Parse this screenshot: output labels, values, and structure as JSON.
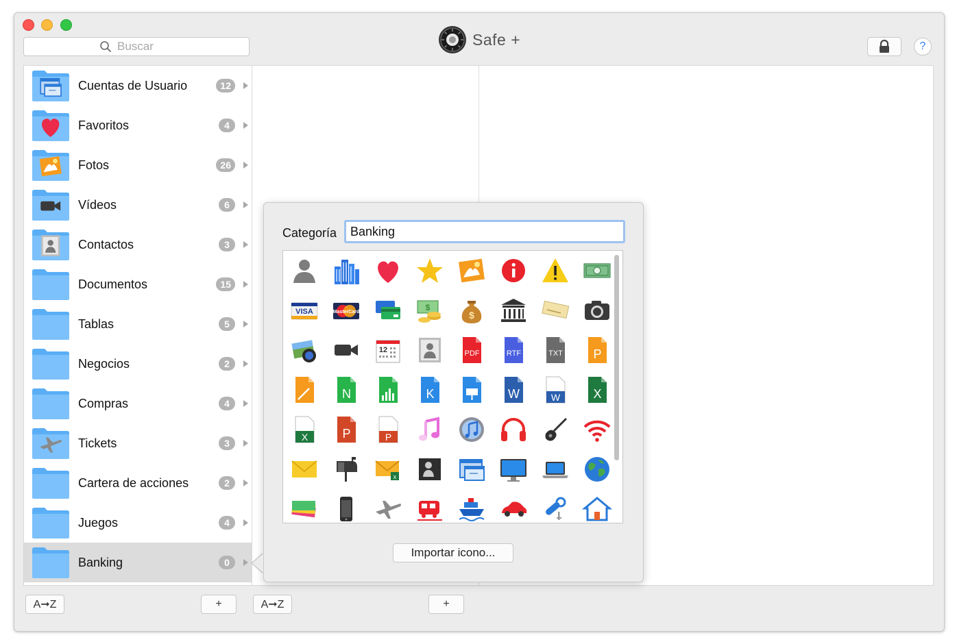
{
  "window": {
    "app_title": "Safe +",
    "search_placeholder": "Buscar"
  },
  "sidebar": {
    "items": [
      {
        "label": "Cuentas de Usuario",
        "count": "12",
        "icon": "browser-window-icon"
      },
      {
        "label": "Favoritos",
        "count": "4",
        "icon": "heart-icon"
      },
      {
        "label": "Fotos",
        "count": "26",
        "icon": "photo-icon"
      },
      {
        "label": "Vídeos",
        "count": "6",
        "icon": "video-camera-icon"
      },
      {
        "label": "Contactos",
        "count": "3",
        "icon": "contacts-icon"
      },
      {
        "label": "Documentos",
        "count": "15",
        "icon": "word-document-icon"
      },
      {
        "label": "Tablas",
        "count": "5",
        "icon": "excel-sheet-icon"
      },
      {
        "label": "Negocios",
        "count": "2",
        "icon": "briefcase-icon"
      },
      {
        "label": "Compras",
        "count": "4",
        "icon": "shopping-bag-icon"
      },
      {
        "label": "Tickets",
        "count": "3",
        "icon": "airplane-icon"
      },
      {
        "label": "Cartera de acciones",
        "count": "2",
        "icon": "stock-chart-icon"
      },
      {
        "label": "Juegos",
        "count": "4",
        "icon": "gamepad-icon"
      },
      {
        "label": "Banking",
        "count": "0",
        "icon": "money-icon",
        "selected": true
      }
    ]
  },
  "bottom_bar": {
    "sort_label": "A➞Z",
    "add_label": "+"
  },
  "popover": {
    "category_label": "Categoría",
    "category_value": "Banking",
    "import_button": "Importar icono...",
    "icon_text": {
      "visa": "VISA",
      "mastercard": "MasterCard",
      "calendar_day": "12",
      "pdf": "PDF",
      "rtf": "RTF",
      "txt": "TXT",
      "pages": "P",
      "numbers": "N",
      "keynote": "K",
      "word": "W",
      "excel": "X",
      "powerpoint": "P"
    },
    "icons": [
      "person-icon",
      "buildings-icon",
      "heart-icon",
      "star-icon",
      "photo-icon",
      "info-icon",
      "warning-icon",
      "banknote-icon",
      "visa-card-icon",
      "mastercard-icon",
      "credit-cards-icon",
      "money-coins-icon",
      "money-bag-icon",
      "bank-icon",
      "check-icon",
      "camera-icon",
      "photos-globe-icon",
      "video-camera-icon",
      "calendar-icon",
      "contacts-icon",
      "pdf-file-icon",
      "rtf-file-icon",
      "txt-file-icon",
      "pages-file-icon",
      "pages-doc-icon",
      "numbers-file-icon",
      "numbers-chart-icon",
      "keynote-file-icon",
      "keynote-doc-icon",
      "word-file-icon",
      "word-doc-icon",
      "excel-file-icon",
      "excel-doc-icon",
      "powerpoint-file-icon",
      "powerpoint-doc-icon",
      "music-note-icon",
      "itunes-icon",
      "headphones-icon",
      "guitar-icon",
      "wifi-icon",
      "envelope-icon",
      "mailbox-icon",
      "mail-excel-icon",
      "contact-card-icon",
      "browser-window-icon",
      "monitor-icon",
      "laptop-icon",
      "globe-icon",
      "tickets-icon",
      "iphone-icon",
      "airplane-icon",
      "train-icon",
      "ship-icon",
      "car-icon",
      "key-icon",
      "house-icon"
    ]
  }
}
